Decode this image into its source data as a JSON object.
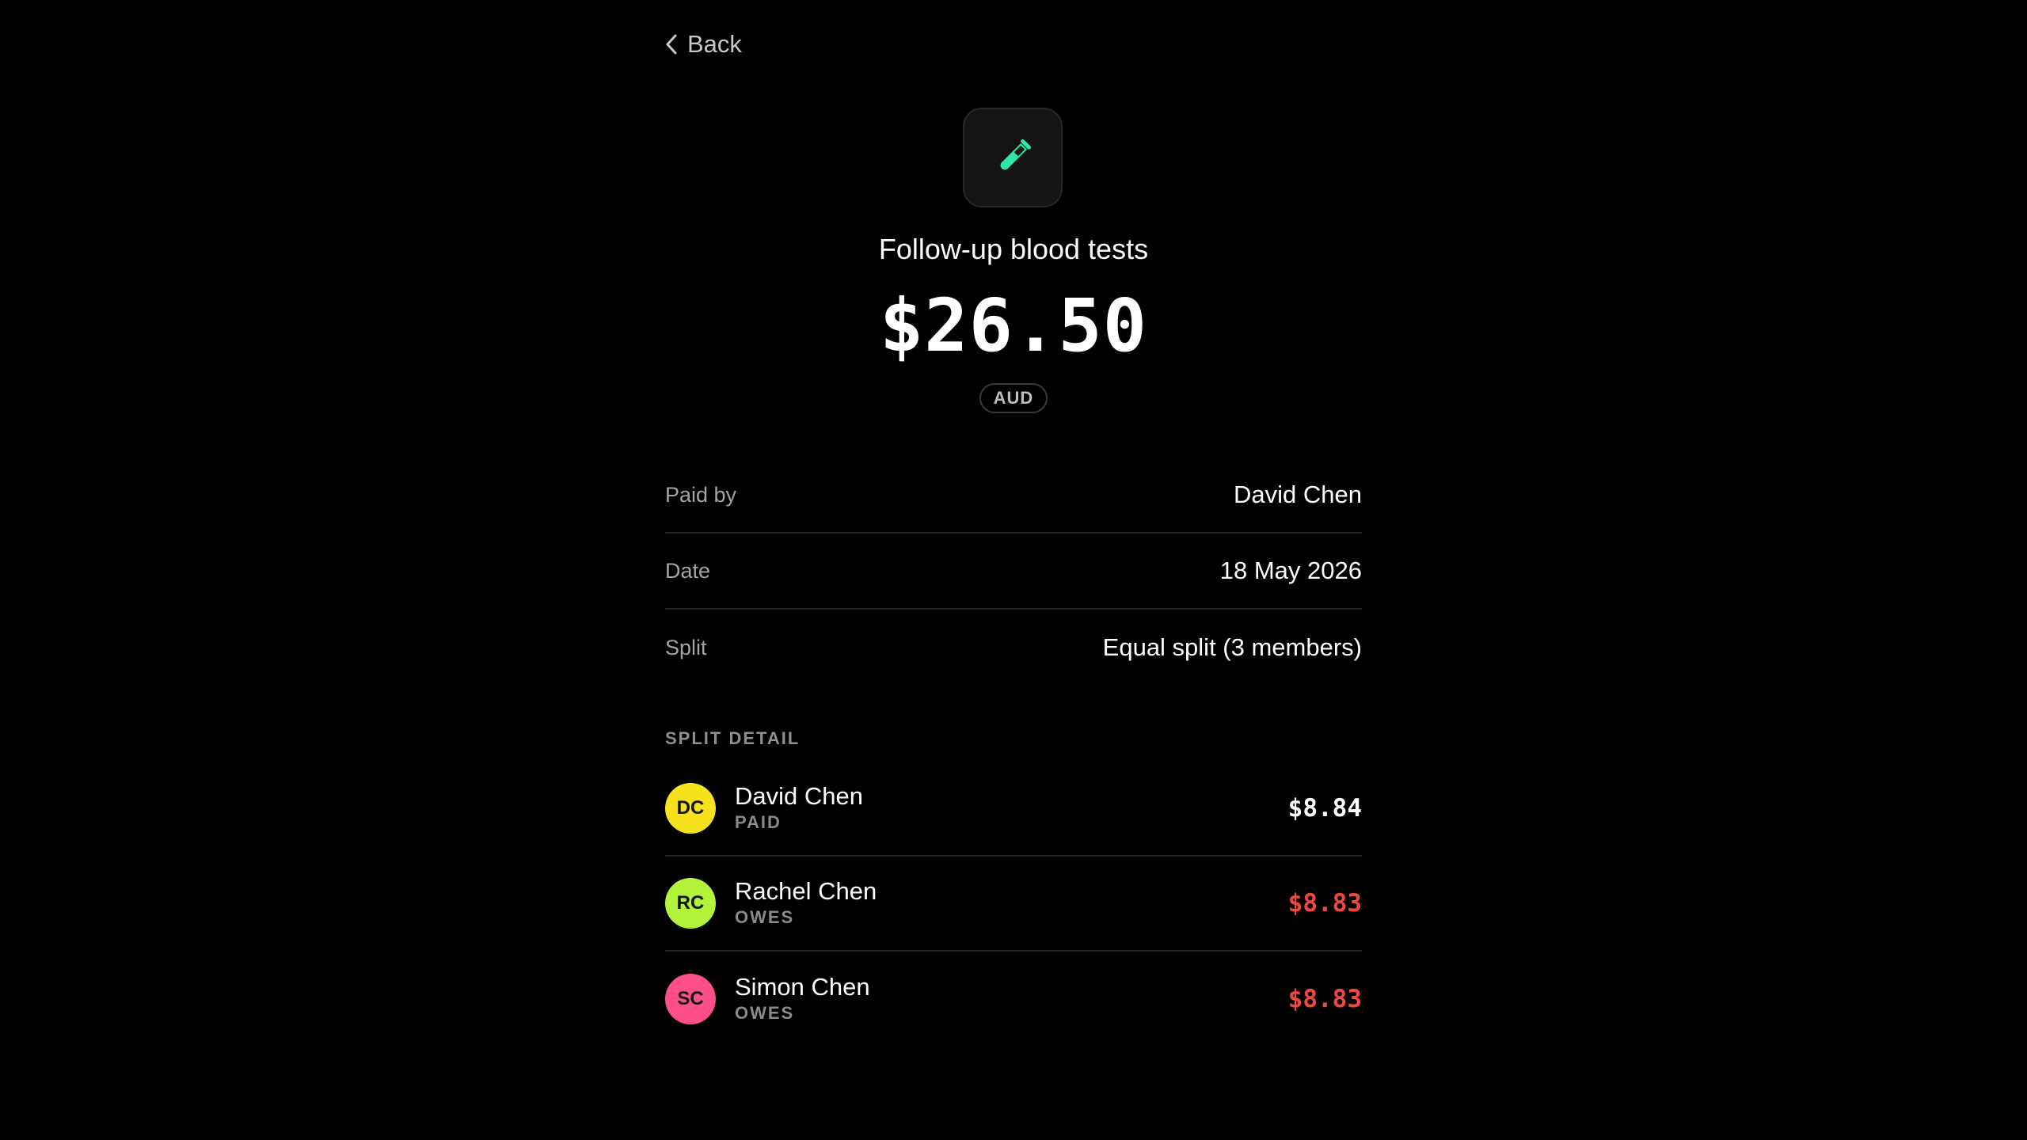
{
  "nav": {
    "back_label": "Back"
  },
  "expense": {
    "icon": "test-tube-icon",
    "icon_color": "#2ee6a6",
    "title": "Follow-up blood tests",
    "amount": "$26.50",
    "currency": "AUD"
  },
  "details": [
    {
      "label": "Paid by",
      "value": "David Chen"
    },
    {
      "label": "Date",
      "value": "18 May 2026"
    },
    {
      "label": "Split",
      "value": "Equal split (3 members)"
    }
  ],
  "split_detail": {
    "heading": "SPLIT DETAIL",
    "members": [
      {
        "initials": "DC",
        "name": "David Chen",
        "status": "PAID",
        "amount": "$8.84",
        "avatar_color": "#f5e11e",
        "amount_color": "#ffffff"
      },
      {
        "initials": "RC",
        "name": "Rachel Chen",
        "status": "OWES",
        "amount": "$8.83",
        "avatar_color": "#b2f23a",
        "amount_color": "#f0483e"
      },
      {
        "initials": "SC",
        "name": "Simon Chen",
        "status": "OWES",
        "amount": "$8.83",
        "avatar_color": "#ff4f8b",
        "amount_color": "#f0483e"
      }
    ]
  }
}
